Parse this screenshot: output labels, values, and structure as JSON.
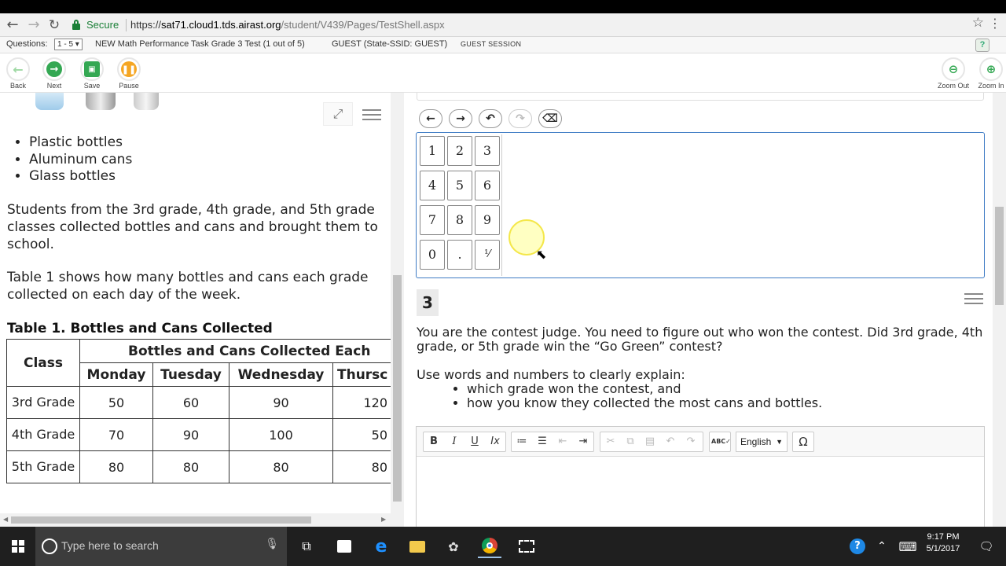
{
  "browser": {
    "secure_label": "Secure",
    "url_scheme": "https://",
    "url_host": "sat71.cloud1.tds.airast.org",
    "url_path": "/student/V439/Pages/TestShell.aspx"
  },
  "infobar": {
    "questions_label": "Questions:",
    "questions_range": "1 - 5 ▾",
    "test_title": "NEW Math Performance Task Grade 3 Test (1 out of 5)",
    "guest": "GUEST (State-SSID: GUEST)",
    "session": "GUEST SESSION",
    "help": "?"
  },
  "toolbar": {
    "back": "Back",
    "next": "Next",
    "save": "Save",
    "pause": "Pause",
    "zoom_out": "Zoom Out",
    "zoom_in": "Zoom In"
  },
  "passage": {
    "bullets": [
      "Plastic bottles",
      "Aluminum cans",
      "Glass bottles"
    ],
    "para1": "Students from the 3rd grade, 4th grade, and 5th grade classes collected bottles and cans and brought them to school.",
    "para2": "Table 1 shows how many bottles and cans each grade collected on each day of the week.",
    "table_caption": "Table 1. Bottles and Cans Collected",
    "table": {
      "class_header": "Class",
      "group_header": "Bottles and Cans Collected Each",
      "days": [
        "Monday",
        "Tuesday",
        "Wednesday",
        "Thursc"
      ],
      "rows": [
        {
          "class": "3rd Grade",
          "values": [
            "50",
            "60",
            "90",
            "120"
          ]
        },
        {
          "class": "4th Grade",
          "values": [
            "70",
            "90",
            "100",
            "50"
          ]
        },
        {
          "class": "5th Grade",
          "values": [
            "80",
            "80",
            "80",
            "80"
          ]
        }
      ]
    }
  },
  "equation": {
    "keys": [
      "1",
      "2",
      "3",
      "4",
      "5",
      "6",
      "7",
      "8",
      "9",
      "0",
      ".",
      "⅟"
    ]
  },
  "question": {
    "number": "3",
    "prompt": "You are the contest judge. You need to figure out who won the contest. Did 3rd grade, 4th grade, or 5th grade win the “Go Green” contest?",
    "instruction": "Use words and numbers to clearly explain:",
    "bullets": [
      "which grade won the contest, and",
      "how you know they collected the most cans and bottles."
    ]
  },
  "editor": {
    "language": "English",
    "omega": "Ω"
  },
  "taskbar": {
    "search_placeholder": "Type here to search",
    "time": "9:17 PM",
    "date": "5/1/2017"
  }
}
